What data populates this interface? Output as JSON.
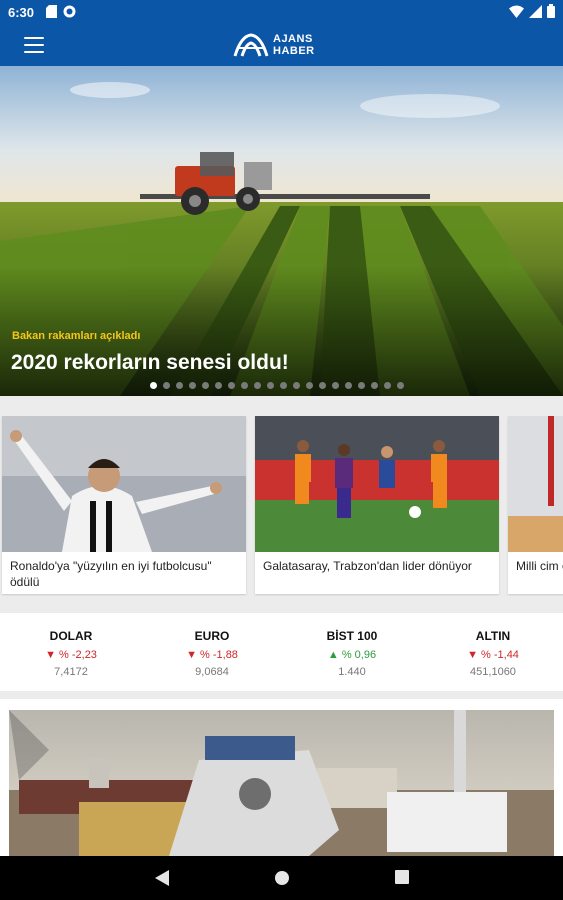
{
  "status_bar": {
    "time": "6:30"
  },
  "app": {
    "logo_line1": "AJANS",
    "logo_line2": "HABER",
    "brand_color": "#0c56a8"
  },
  "hero": {
    "kicker": "Bakan rakamları açıkladı",
    "title": "2020 rekorların senesi oldu!",
    "slide_count": 20,
    "active_slide": 0
  },
  "cards": [
    {
      "title": "Ronaldo'ya \"yüzyılın en iyi futbolcusu\" ödülü"
    },
    {
      "title": "Galatasaray, Trabzon'dan lider dönüyor"
    },
    {
      "title": "Milli cim olimpiya"
    }
  ],
  "markets": [
    {
      "name": "DOLAR",
      "direction": "down",
      "arrow": "▼",
      "change": "% -2,23",
      "value": "7,4172"
    },
    {
      "name": "EURO",
      "direction": "down",
      "arrow": "▼",
      "change": "% -1,88",
      "value": "9,0684"
    },
    {
      "name": "BİST 100",
      "direction": "up",
      "arrow": "▲",
      "change": "% 0,96",
      "value": "1.440"
    },
    {
      "name": "ALTIN",
      "direction": "down",
      "arrow": "▼",
      "change": "% -1,44",
      "value": "451,1060"
    }
  ],
  "colors": {
    "down": "#d0262b",
    "up": "#2e9c3e",
    "kicker": "#f5c518"
  }
}
